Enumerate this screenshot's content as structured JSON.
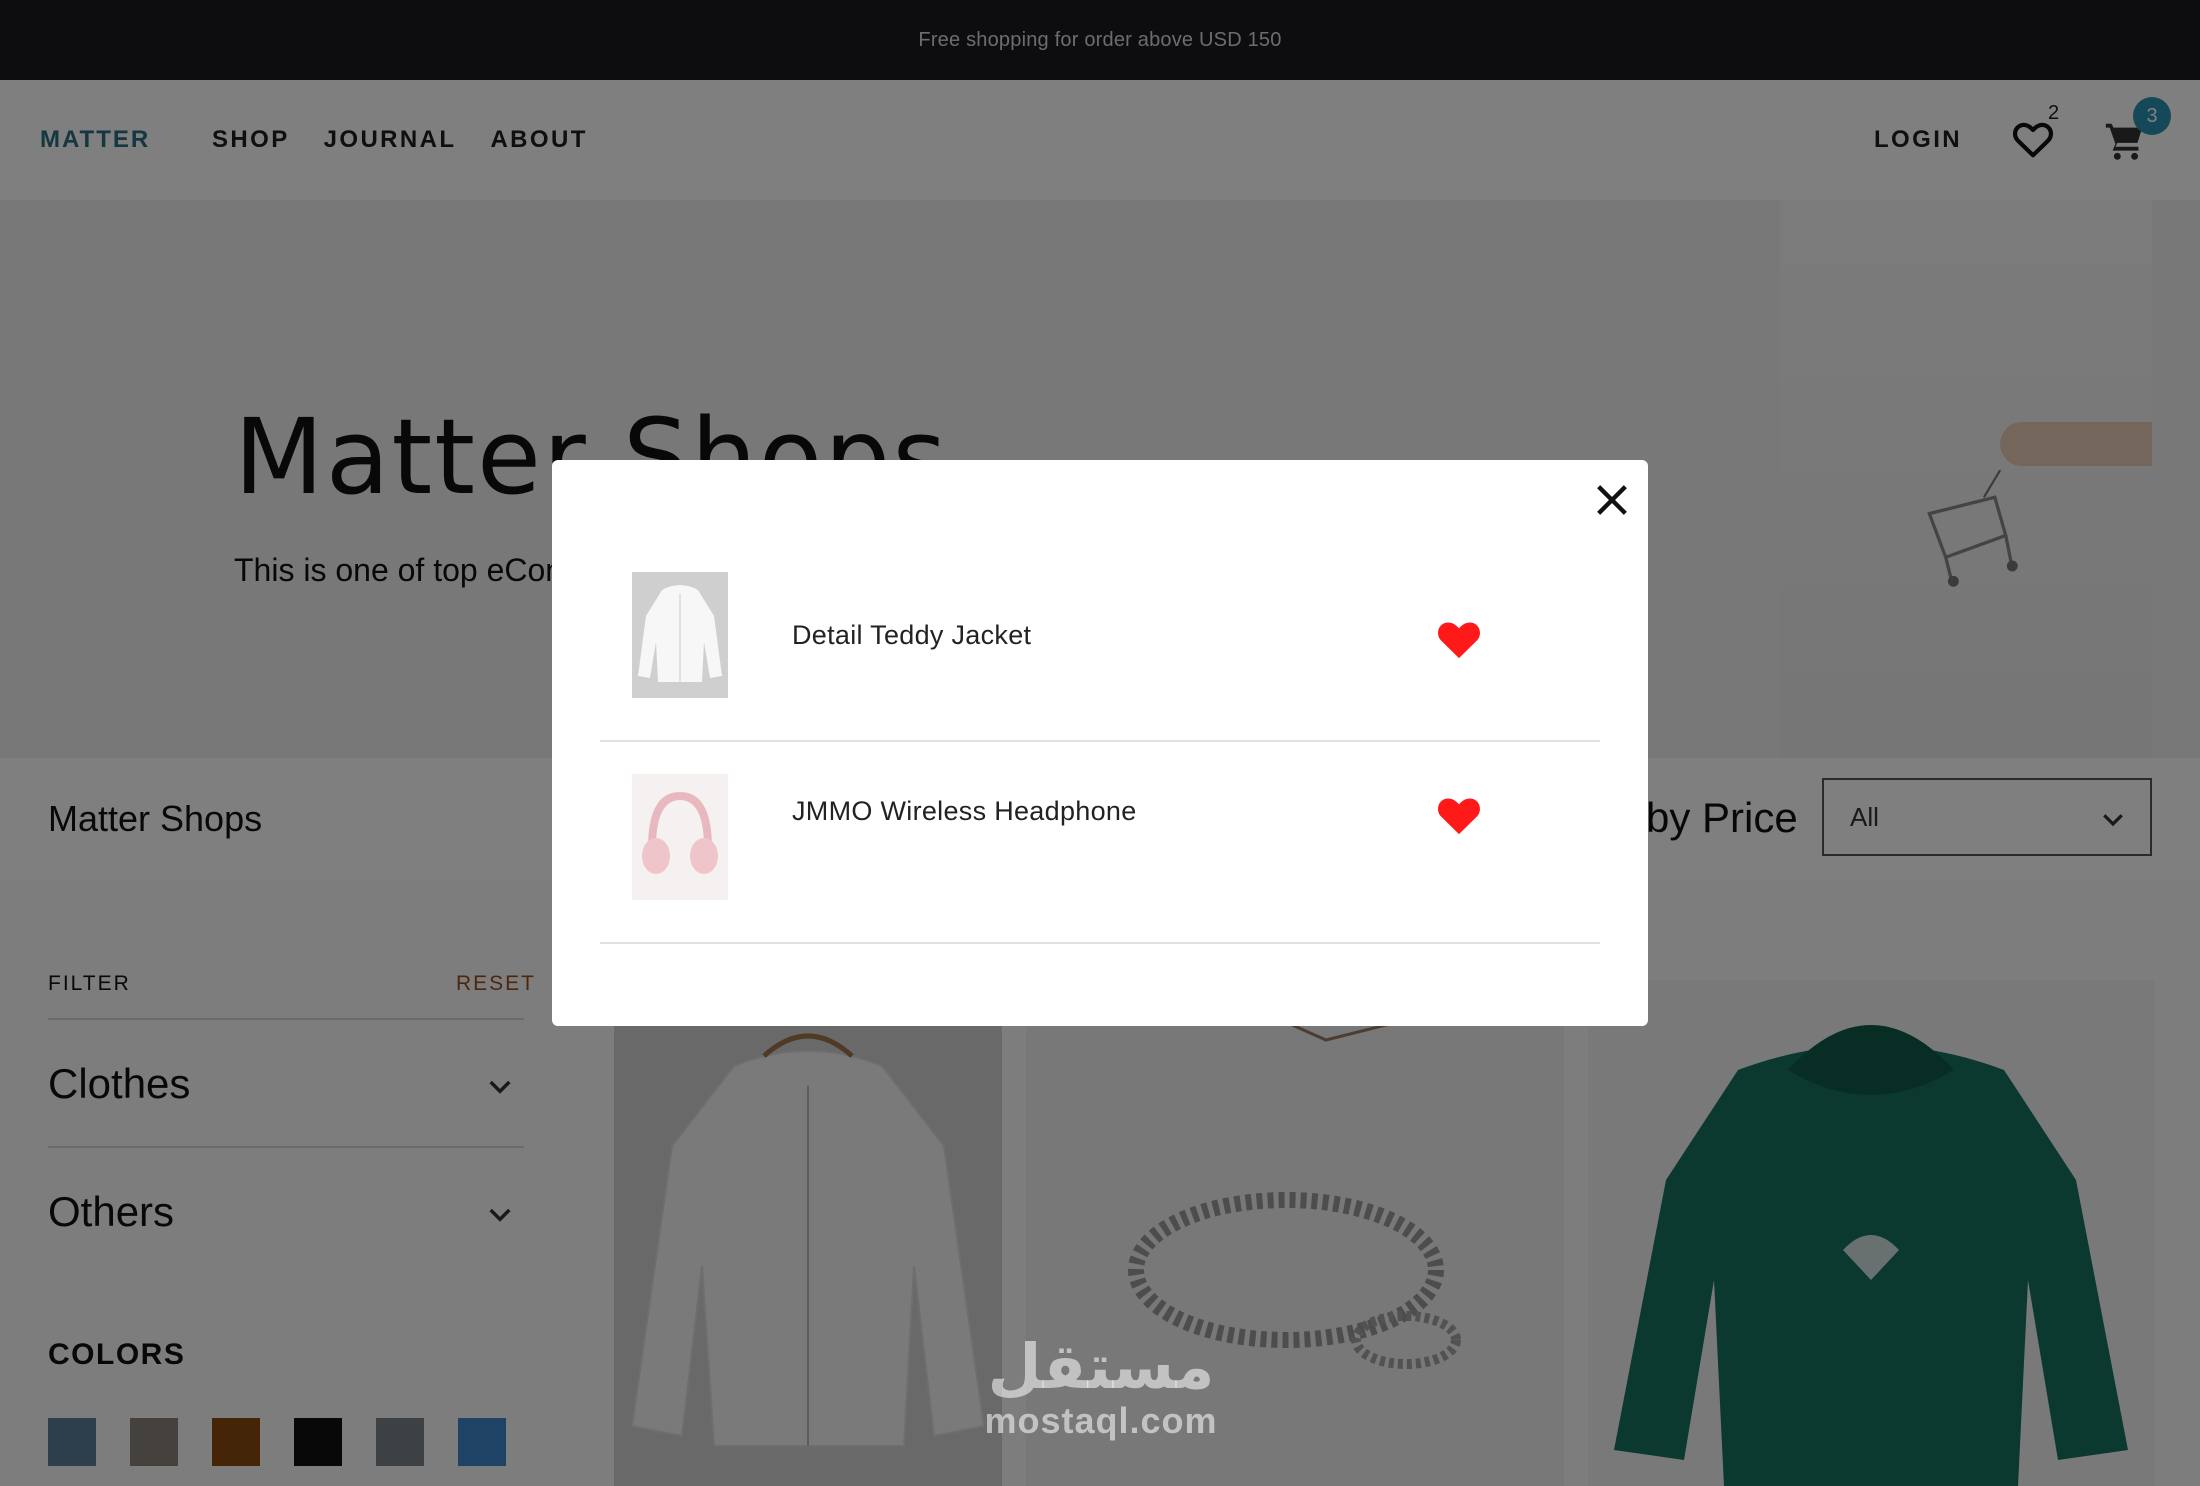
{
  "announcement": "Free shopping for order above USD 150",
  "header": {
    "logo": "MATTER",
    "nav": [
      "SHOP",
      "JOURNAL",
      "ABOUT"
    ],
    "login": "LOGIN",
    "wishlist_count": "2",
    "cart_count": "3"
  },
  "hero": {
    "title": "Matter Shops",
    "subtitle": "This is one of top eCom"
  },
  "toolbar": {
    "title": "Matter Shops",
    "sort_label": "by Price",
    "sort_value": "All"
  },
  "sidebar": {
    "filter_label": "FILTER",
    "reset_label": "RESET",
    "categories": [
      "Clothes",
      "Others"
    ],
    "colors_label": "COLORS",
    "colors": [
      "#5b7e99",
      "#8a8279",
      "#8a4a0e",
      "#111111",
      "#7d8387",
      "#3f86c8"
    ]
  },
  "wishlist_modal": {
    "items": [
      {
        "name": "Detail Teddy Jacket",
        "favorited": true
      },
      {
        "name": "JMMO Wireless Headphone",
        "favorited": true
      }
    ]
  },
  "watermark": {
    "arabic": "مستقل",
    "latin": "mostaql.com"
  }
}
